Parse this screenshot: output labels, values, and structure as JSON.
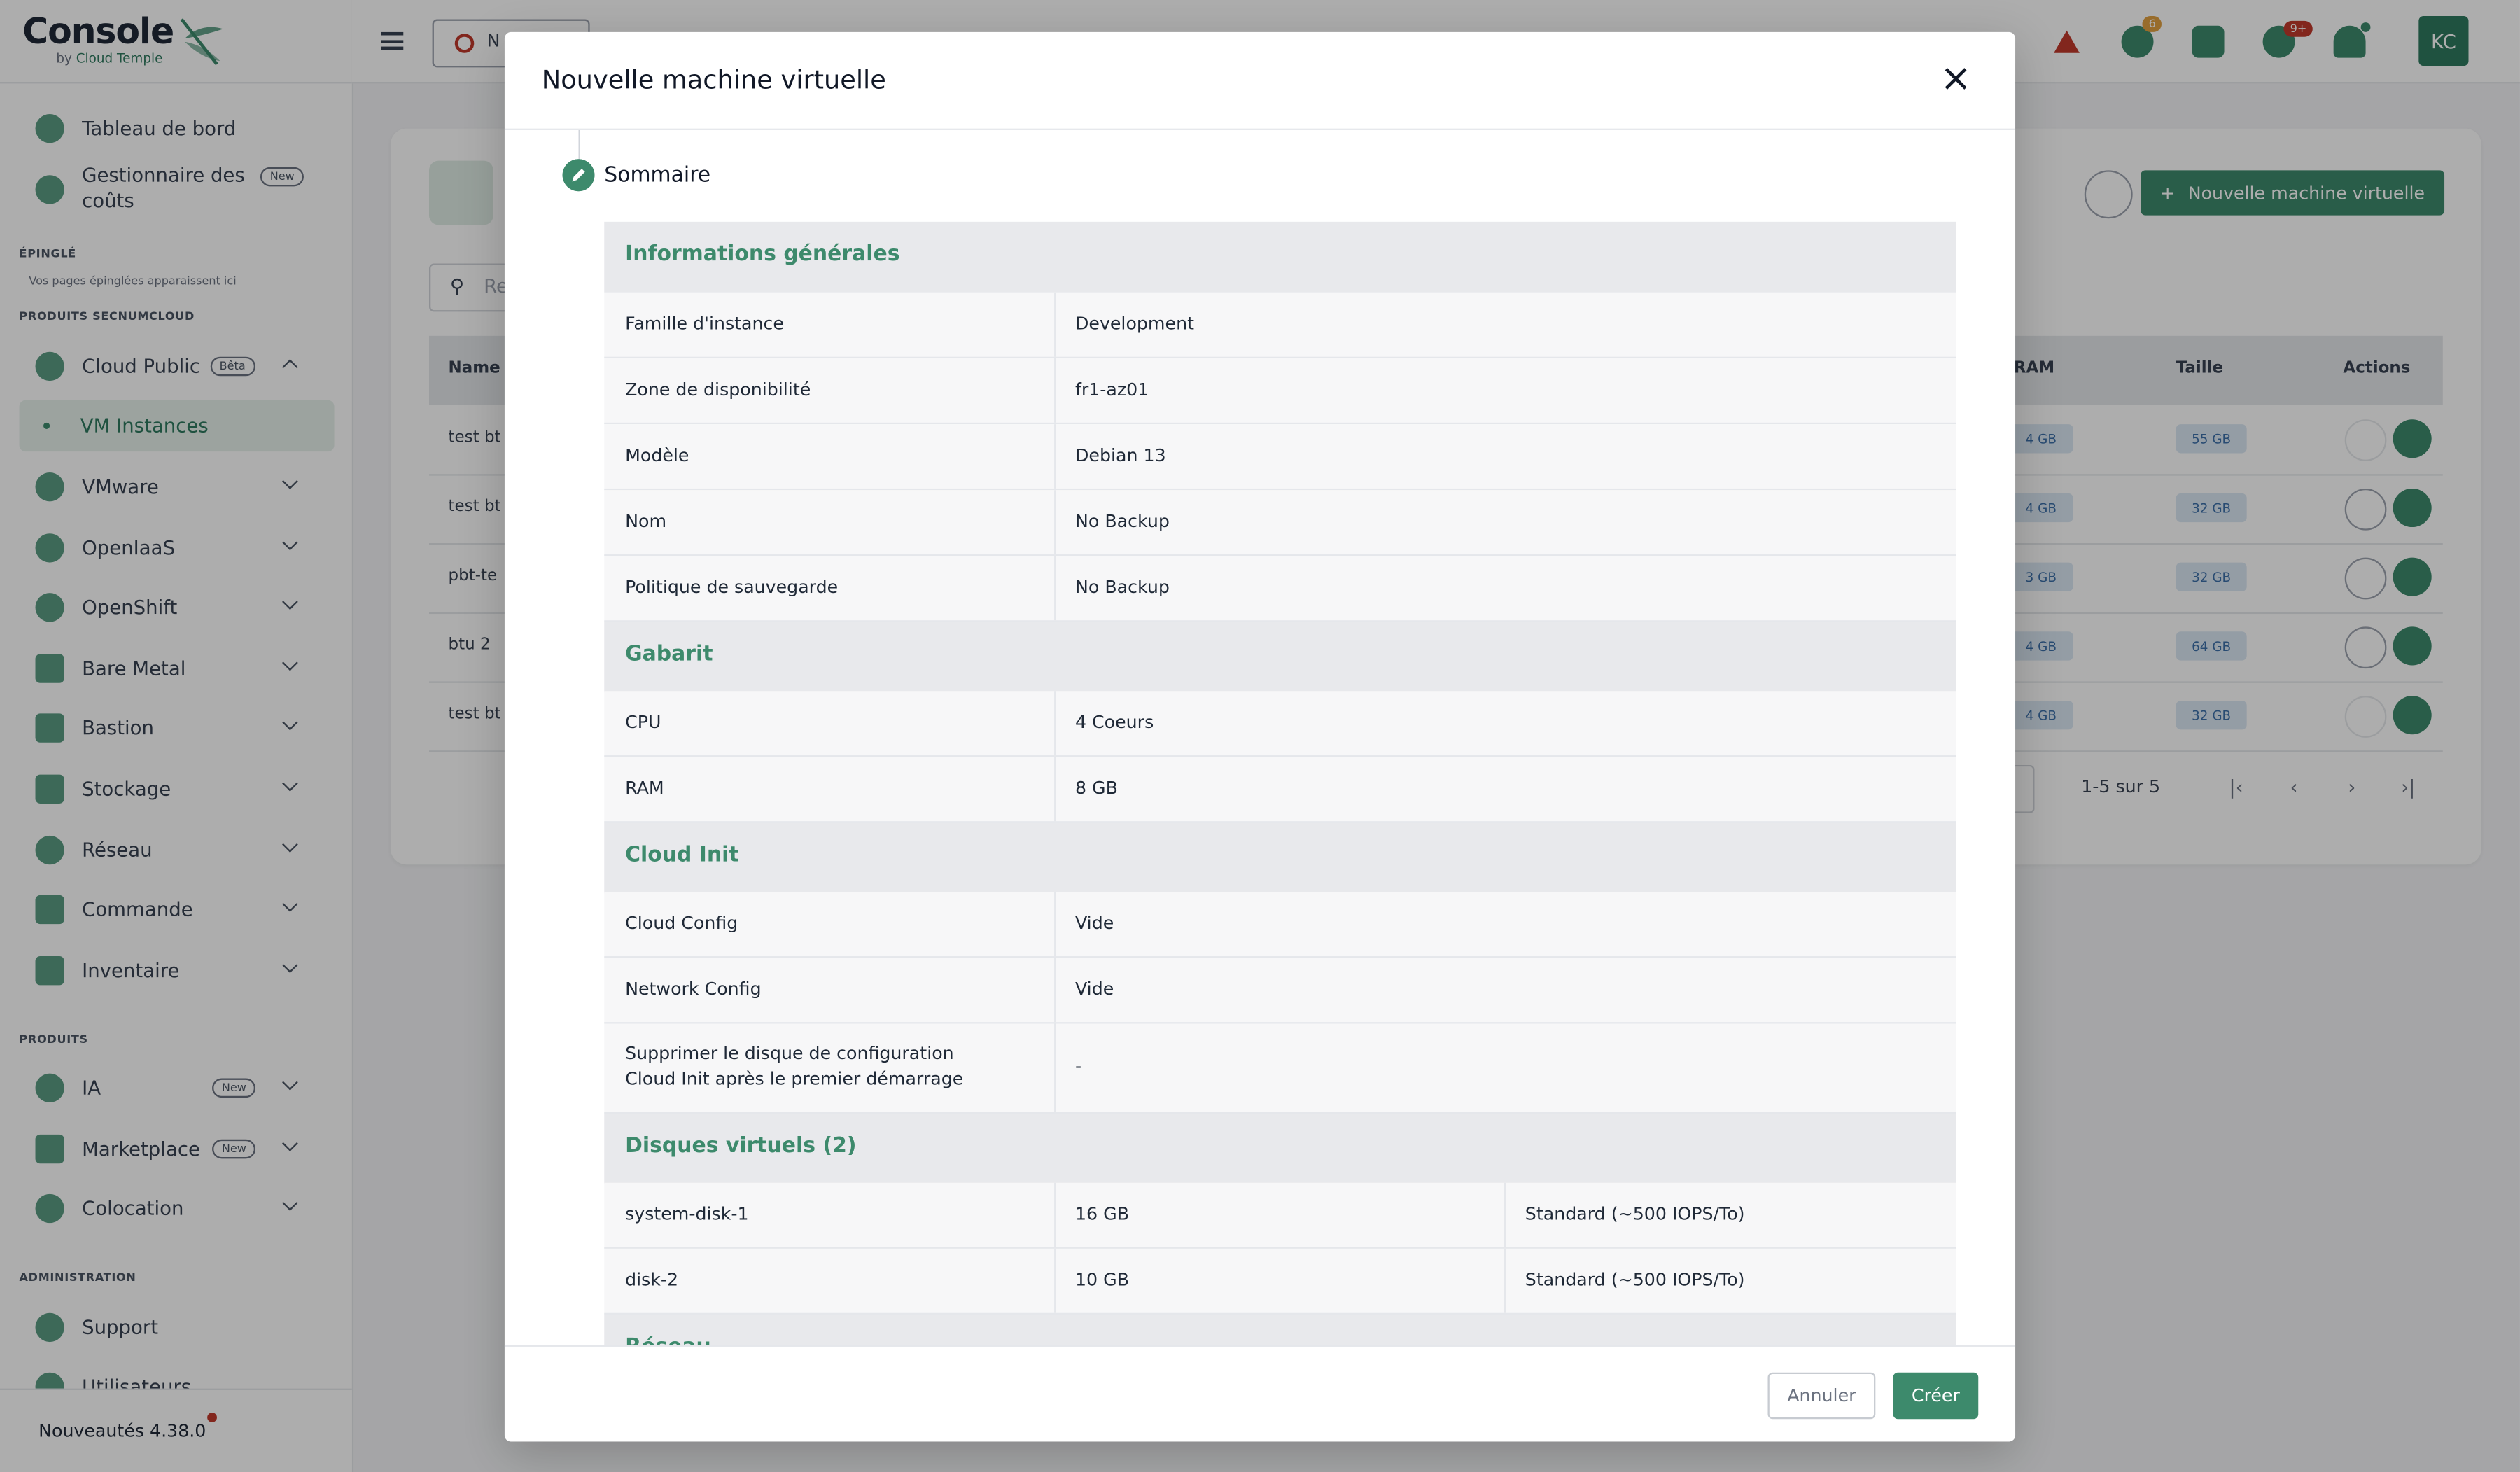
{
  "app": {
    "logo_text": "Console",
    "logo_by": "by",
    "logo_brand": "Cloud Temple"
  },
  "sidebar": {
    "top_items": [
      {
        "label": "Tableau de bord"
      },
      {
        "label": "Gestionnaire des coûts",
        "badge": "New"
      }
    ],
    "pinned_title": "ÉPINGLÉ",
    "pinned_hint": "Vos pages épinglées apparaissent ici",
    "secnum_title": "PRODUITS SECNUMCLOUD",
    "secnum_items": [
      {
        "label": "Cloud Public",
        "badge": "Bêta"
      },
      {
        "label": "VM Instances"
      },
      {
        "label": "VMware"
      },
      {
        "label": "OpenIaaS"
      },
      {
        "label": "OpenShift"
      },
      {
        "label": "Bare Metal"
      },
      {
        "label": "Bastion"
      },
      {
        "label": "Stockage"
      },
      {
        "label": "Réseau"
      },
      {
        "label": "Commande"
      },
      {
        "label": "Inventaire"
      }
    ],
    "products_title": "PRODUITS",
    "products_items": [
      {
        "label": "IA",
        "badge": "New"
      },
      {
        "label": "Marketplace",
        "badge": "New"
      },
      {
        "label": "Colocation"
      }
    ],
    "admin_title": "ADMINISTRATION",
    "admin_items": [
      {
        "label": "Support"
      },
      {
        "label": "Utilisateurs"
      }
    ],
    "footer_news": "Nouveautés 4.38.0"
  },
  "topbar": {
    "select_text": "N",
    "badges": {
      "first": "6",
      "second": "9+"
    },
    "avatar": "KC"
  },
  "main": {
    "new_vm_button": "Nouvelle machine virtuelle",
    "search_placeholder": "Re",
    "columns": {
      "name": "Name",
      "ram": "RAM",
      "taille": "Taille",
      "actions": "Actions"
    },
    "rows": [
      {
        "name": "test bt",
        "ram": "4 GB",
        "taille": "55 GB"
      },
      {
        "name": "test bt",
        "ram": "4 GB",
        "taille": "32 GB"
      },
      {
        "name": "pbt-te",
        "ram": "3 GB",
        "taille": "32 GB"
      },
      {
        "name": "btu 2",
        "ram": "4 GB",
        "taille": "64 GB"
      },
      {
        "name": "test bt",
        "ram": "4 GB",
        "taille": "32 GB"
      }
    ],
    "pager_text": "1-5 sur 5"
  },
  "modal": {
    "title": "Nouvelle machine virtuelle",
    "step_label": "Sommaire",
    "sections": {
      "general": {
        "title": "Informations générales",
        "rows": [
          {
            "label": "Famille d'instance",
            "value": "Development"
          },
          {
            "label": "Zone de disponibilité",
            "value": "fr1-az01"
          },
          {
            "label": "Modèle",
            "value": "Debian 13"
          },
          {
            "label": "Nom",
            "value": "No Backup"
          },
          {
            "label": "Politique de sauvegarde",
            "value": "No Backup"
          }
        ]
      },
      "gabarit": {
        "title": "Gabarit",
        "rows": [
          {
            "label": "CPU",
            "value": "4 Coeurs"
          },
          {
            "label": "RAM",
            "value": "8 GB"
          }
        ]
      },
      "cloudinit": {
        "title": "Cloud Init",
        "rows": [
          {
            "label": "Cloud Config",
            "value": "Vide"
          },
          {
            "label": "Network Config",
            "value": "Vide"
          },
          {
            "label_line1": "Supprimer le disque de configuration",
            "label_line2": "Cloud Init après le premier démarrage",
            "value": "-"
          }
        ]
      },
      "disks": {
        "title": "Disques virtuels (2)",
        "rows": [
          {
            "label": "system-disk-1",
            "size": "16 GB",
            "type": "Standard (~500 IOPS/To)"
          },
          {
            "label": "disk-2",
            "size": "10 GB",
            "type": "Standard (~500 IOPS/To)"
          }
        ]
      },
      "network": {
        "title": "Réseau"
      }
    },
    "cancel_label": "Annuler",
    "create_label": "Créer"
  },
  "colors": {
    "accent": "#3d8a6c",
    "accent_light": "#e6f0eb",
    "chip_bg": "#dbe7f4",
    "chip_text": "#3b6fa8",
    "danger": "#c0392b",
    "badge_orange": "#e0a040"
  }
}
